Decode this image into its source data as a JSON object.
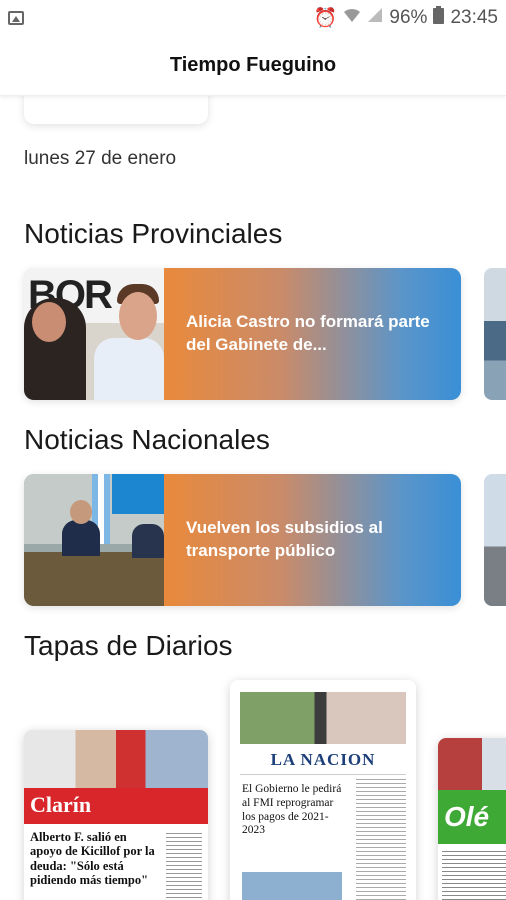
{
  "status_bar": {
    "battery": "96%",
    "time": "23:45"
  },
  "app_bar": {
    "title": "Tiempo Fueguino"
  },
  "date": "lunes 27 de enero",
  "sections": {
    "provinciales": {
      "title": "Noticias Provinciales",
      "cards": [
        {
          "headline": "Alicia Castro no formará parte del Gabinete de..."
        }
      ]
    },
    "nacionales": {
      "title": "Noticias Nacionales",
      "cards": [
        {
          "headline": "Vuelven los subsidios al transporte público"
        }
      ]
    },
    "tapas": {
      "title": "Tapas de Diarios",
      "papers": [
        {
          "name": "Clarín",
          "headline": "Alberto F. salió en apoyo de Kicillof por la deuda: \"Sólo está pidiendo más tiempo\""
        },
        {
          "name": "LA NACION",
          "headline": "El Gobierno le pedirá al FMI reprogramar los pagos de 2021-2023"
        },
        {
          "name": "Olé"
        }
      ]
    }
  },
  "colors": {
    "gradient_start": "#e98a3c",
    "gradient_end": "#3a8fd6",
    "clarin_red": "#d8262a",
    "ole_green": "#3fa936",
    "nacion_blue": "#1c3f7a"
  }
}
